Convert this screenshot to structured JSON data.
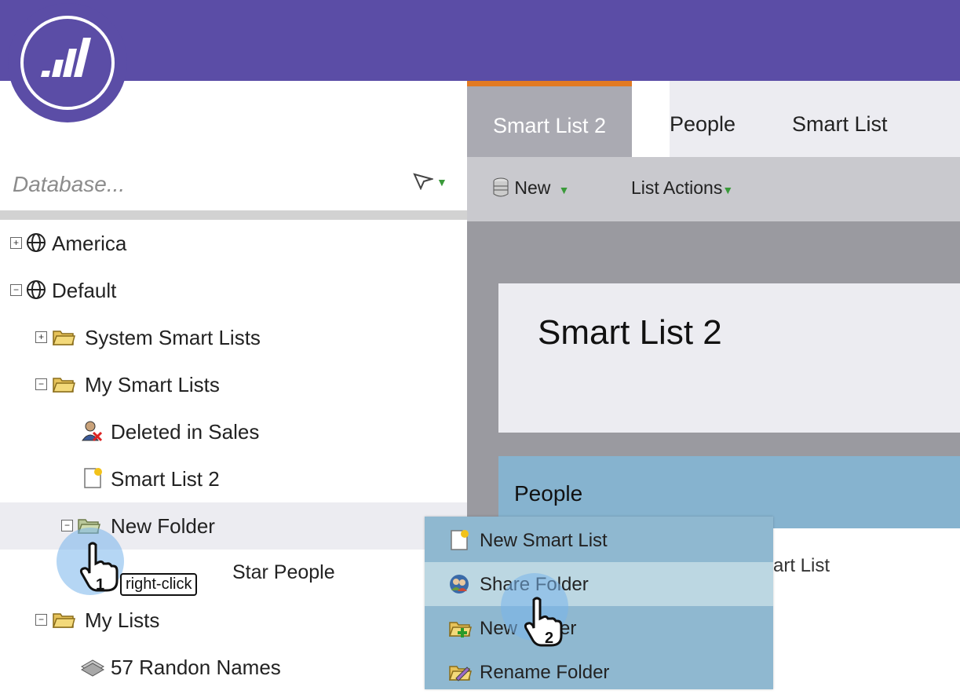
{
  "header": {
    "logo": "marketo-logo-icon",
    "brand_color": "#5b4da6"
  },
  "tabs": [
    {
      "label": "Smart List 2",
      "active": true
    },
    {
      "label": "People",
      "active": false
    },
    {
      "label": "Smart List",
      "active": false
    }
  ],
  "toolbar": {
    "new_label": "New",
    "list_actions_label": "List Actions"
  },
  "search": {
    "placeholder": "Database..."
  },
  "tree": {
    "america": "America",
    "default": "Default",
    "system_smart_lists": "System Smart Lists",
    "my_smart_lists": "My Smart Lists",
    "deleted_in_sales": "Deleted in Sales",
    "smart_list_2": "Smart List 2",
    "new_folder": "New Folder",
    "star_people": "Star People",
    "my_lists": "My Lists",
    "random_names": "57 Randon Names"
  },
  "main": {
    "title": "Smart List 2",
    "people_header": "People",
    "people_sub": "art List"
  },
  "context_menu": {
    "new_smart_list": "New Smart List",
    "share_folder": "Share Folder",
    "new_folder": "New Folder",
    "new_folder_visible_left": "New",
    "new_folder_visible_right": "er",
    "rename_folder": "Rename Folder"
  },
  "annotations": {
    "step1_num": "1",
    "step1_label": "right-click",
    "step2_num": "2"
  },
  "colors": {
    "accent_tab": "#e27a22",
    "menu_bg": "#8fb8d0",
    "menu_highlight": "#bcd7e2",
    "panel_header": "#86b3cf"
  }
}
